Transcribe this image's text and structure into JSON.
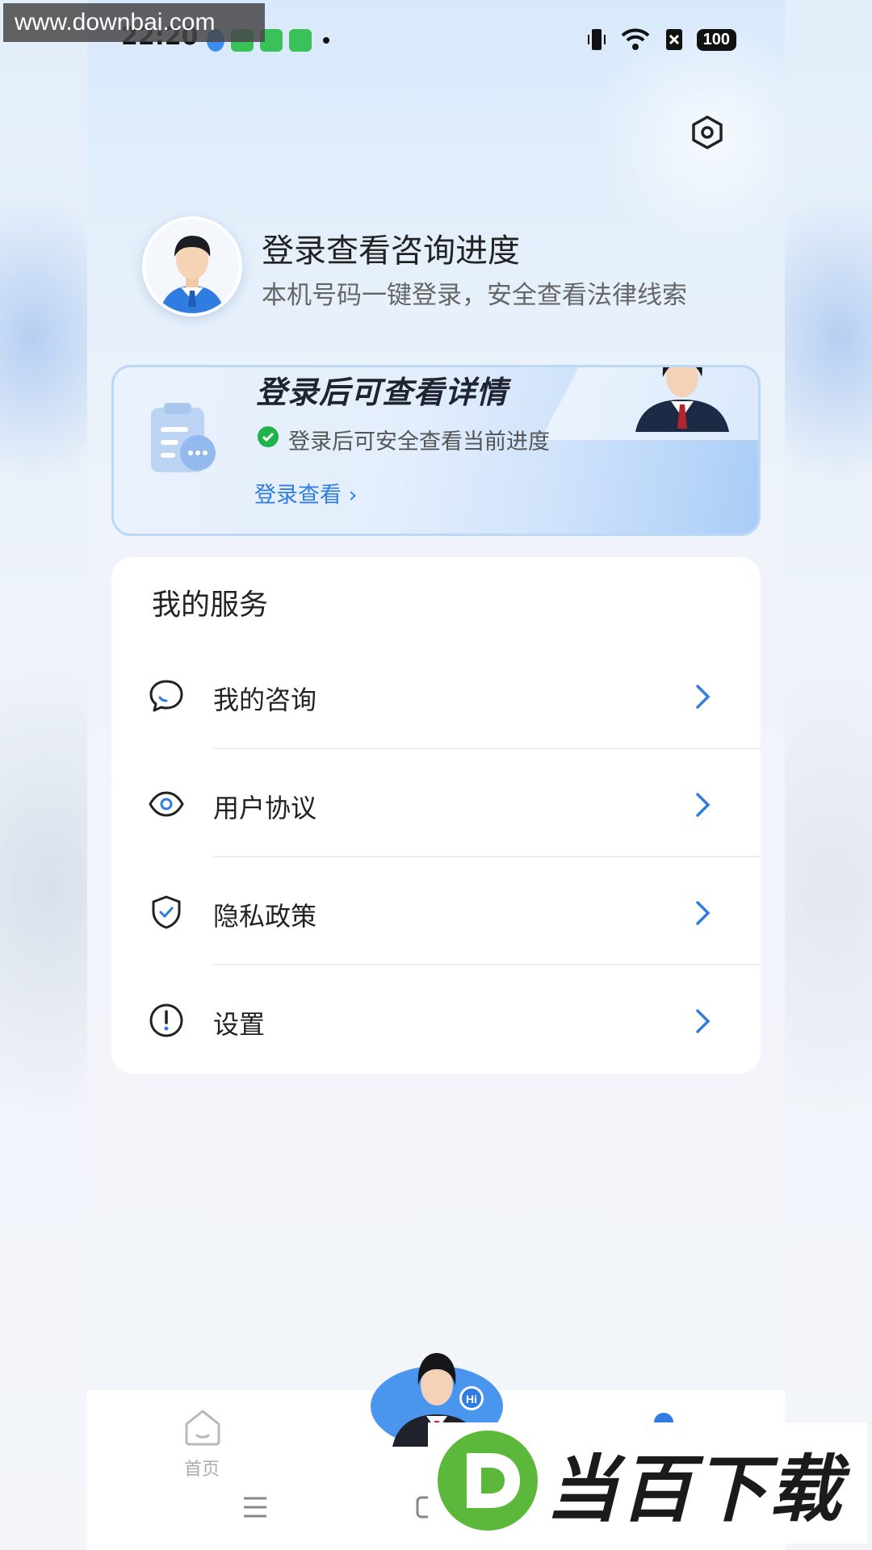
{
  "watermark": {
    "site": "www.downbai.com",
    "brand": "当百下载"
  },
  "statusbar": {
    "time": "22:20",
    "battery": "100"
  },
  "profile": {
    "title": "登录查看咨询进度",
    "subtitle": "本机号码一键登录，安全查看法律线索"
  },
  "login_card": {
    "title": "登录后可查看详情",
    "note": "登录后可安全查看当前进度",
    "link": "登录查看 ›"
  },
  "services": {
    "title": "我的服务",
    "items": [
      {
        "label": "我的咨询",
        "icon": "chat-bubble-icon"
      },
      {
        "label": "用户协议",
        "icon": "eye-icon"
      },
      {
        "label": "隐私政策",
        "icon": "shield-check-icon"
      },
      {
        "label": "设置",
        "icon": "info-circle-icon"
      }
    ]
  },
  "bottom_nav": {
    "home_label": "首页",
    "bot_badge": "Hi"
  },
  "colors": {
    "accent": "#2f7de0",
    "text": "#222222",
    "subtext": "#666666"
  }
}
